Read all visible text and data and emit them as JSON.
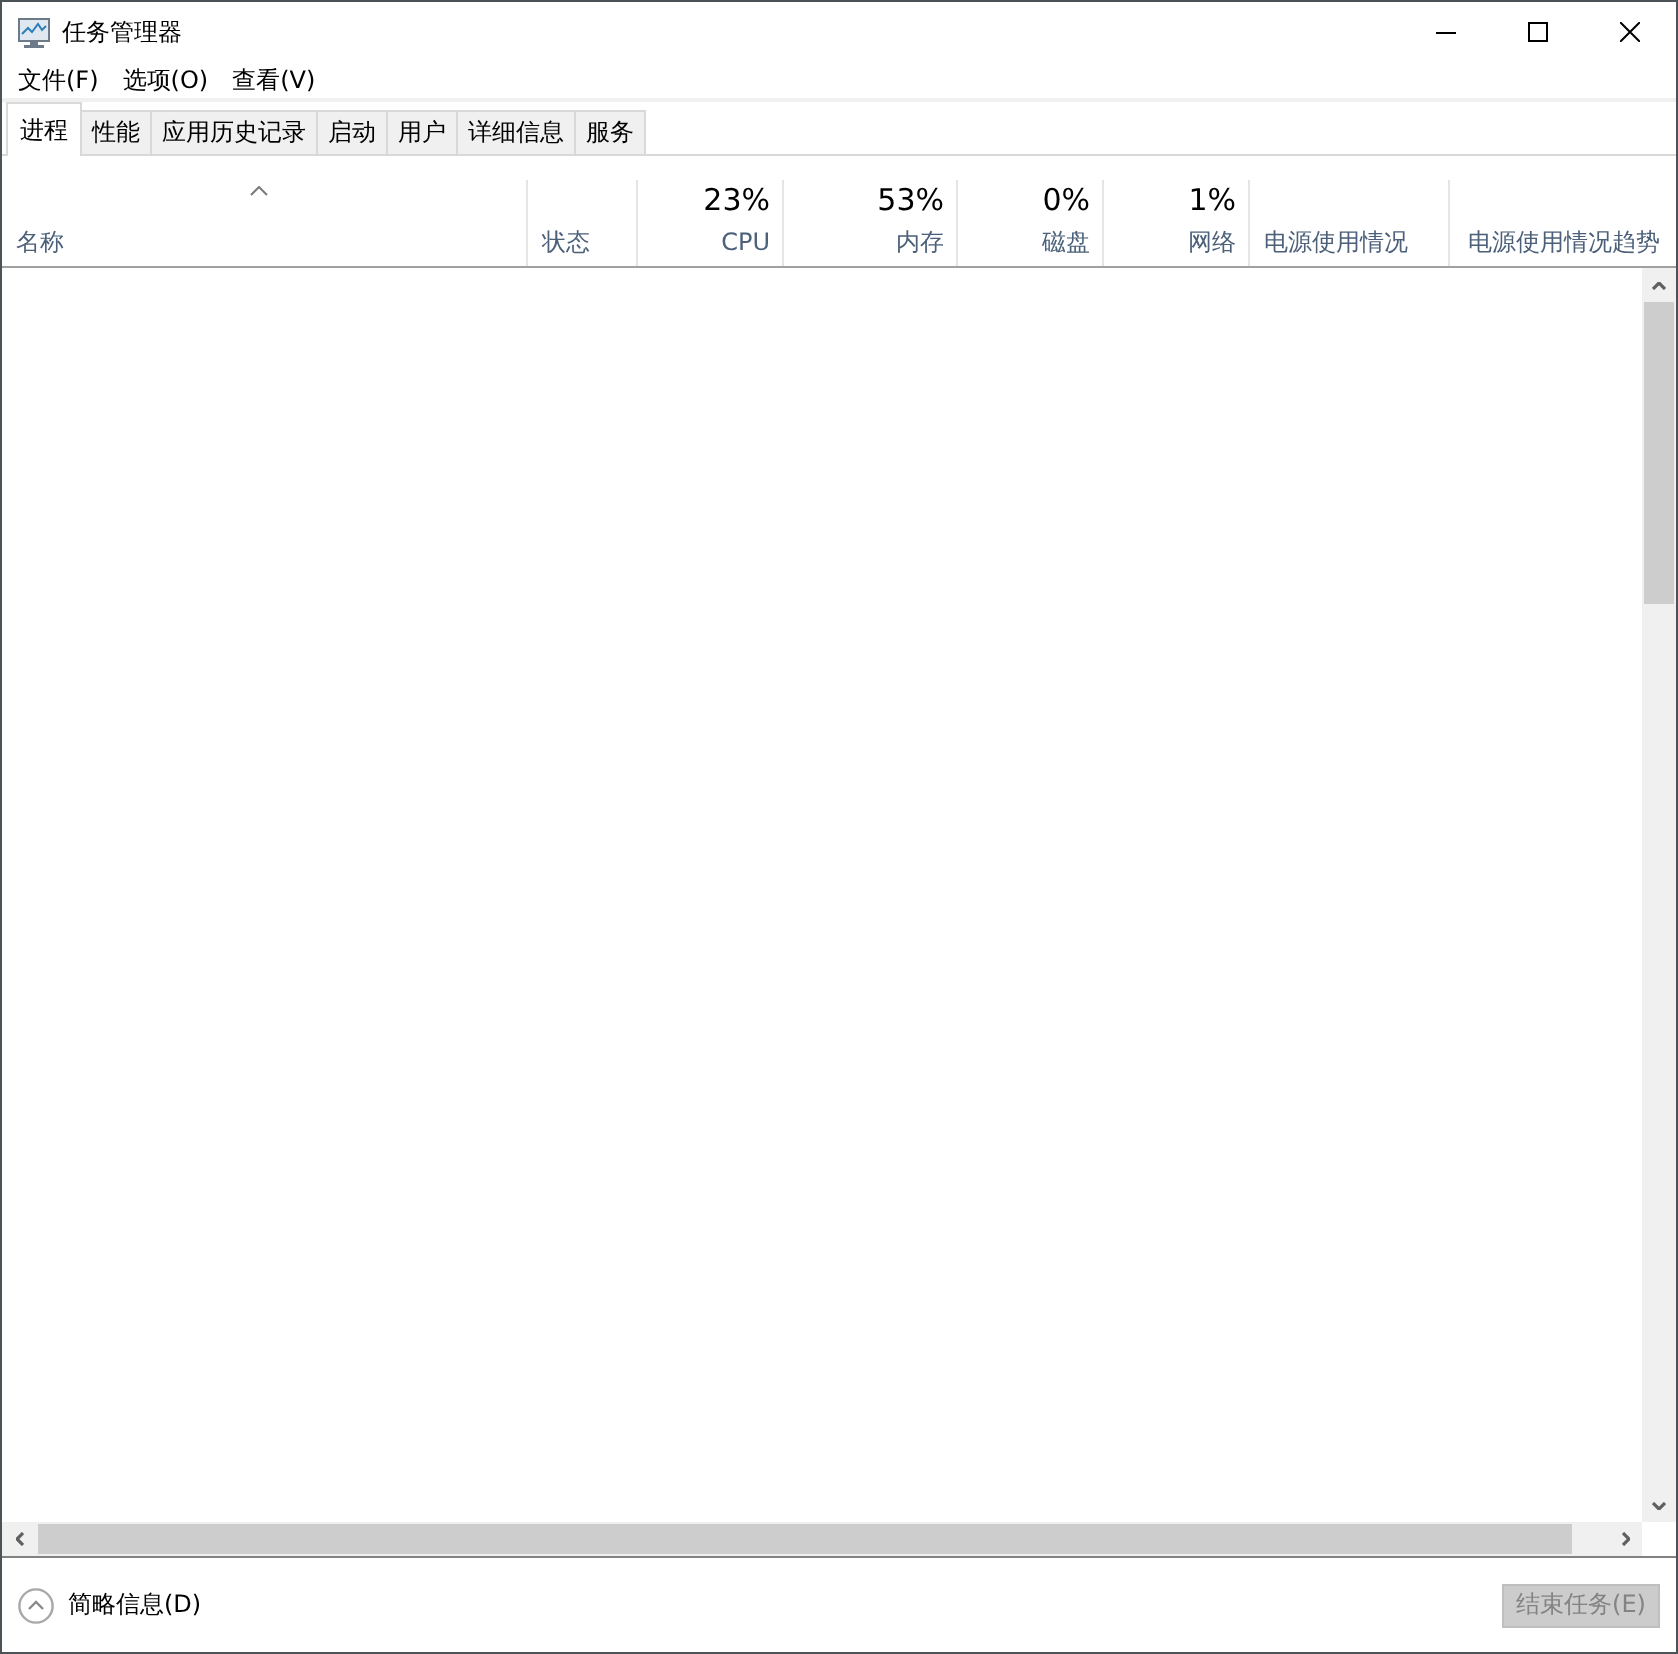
{
  "window": {
    "title": "任务管理器"
  },
  "menu": [
    "文件(F)",
    "选项(O)",
    "查看(V)"
  ],
  "tabs": [
    {
      "label": "进程",
      "selected": true
    },
    {
      "label": "性能",
      "selected": false
    },
    {
      "label": "应用历史记录",
      "selected": false
    },
    {
      "label": "启动",
      "selected": false
    },
    {
      "label": "用户",
      "selected": false
    },
    {
      "label": "详细信息",
      "selected": false
    },
    {
      "label": "服务",
      "selected": false
    }
  ],
  "columns": [
    {
      "kind": "name",
      "label": "名称",
      "sorted": true
    },
    {
      "kind": "text",
      "label": "状态",
      "sorted": false
    },
    {
      "kind": "metric",
      "usage": "23%",
      "label": "CPU",
      "sorted": false
    },
    {
      "kind": "metric",
      "usage": "53%",
      "label": "内存",
      "sorted": false
    },
    {
      "kind": "metric",
      "usage": "0%",
      "label": "磁盘",
      "sorted": false
    },
    {
      "kind": "metric",
      "usage": "1%",
      "label": "网络",
      "sorted": false
    },
    {
      "kind": "text",
      "label": "电源使用情况",
      "sorted": false
    },
    {
      "kind": "text",
      "label": "电源使用情况趋势",
      "sorted": false
    }
  ],
  "footer": {
    "details_toggle": "简略信息(D)",
    "end_task": {
      "label": "结束任务(E)",
      "disabled": true
    }
  }
}
